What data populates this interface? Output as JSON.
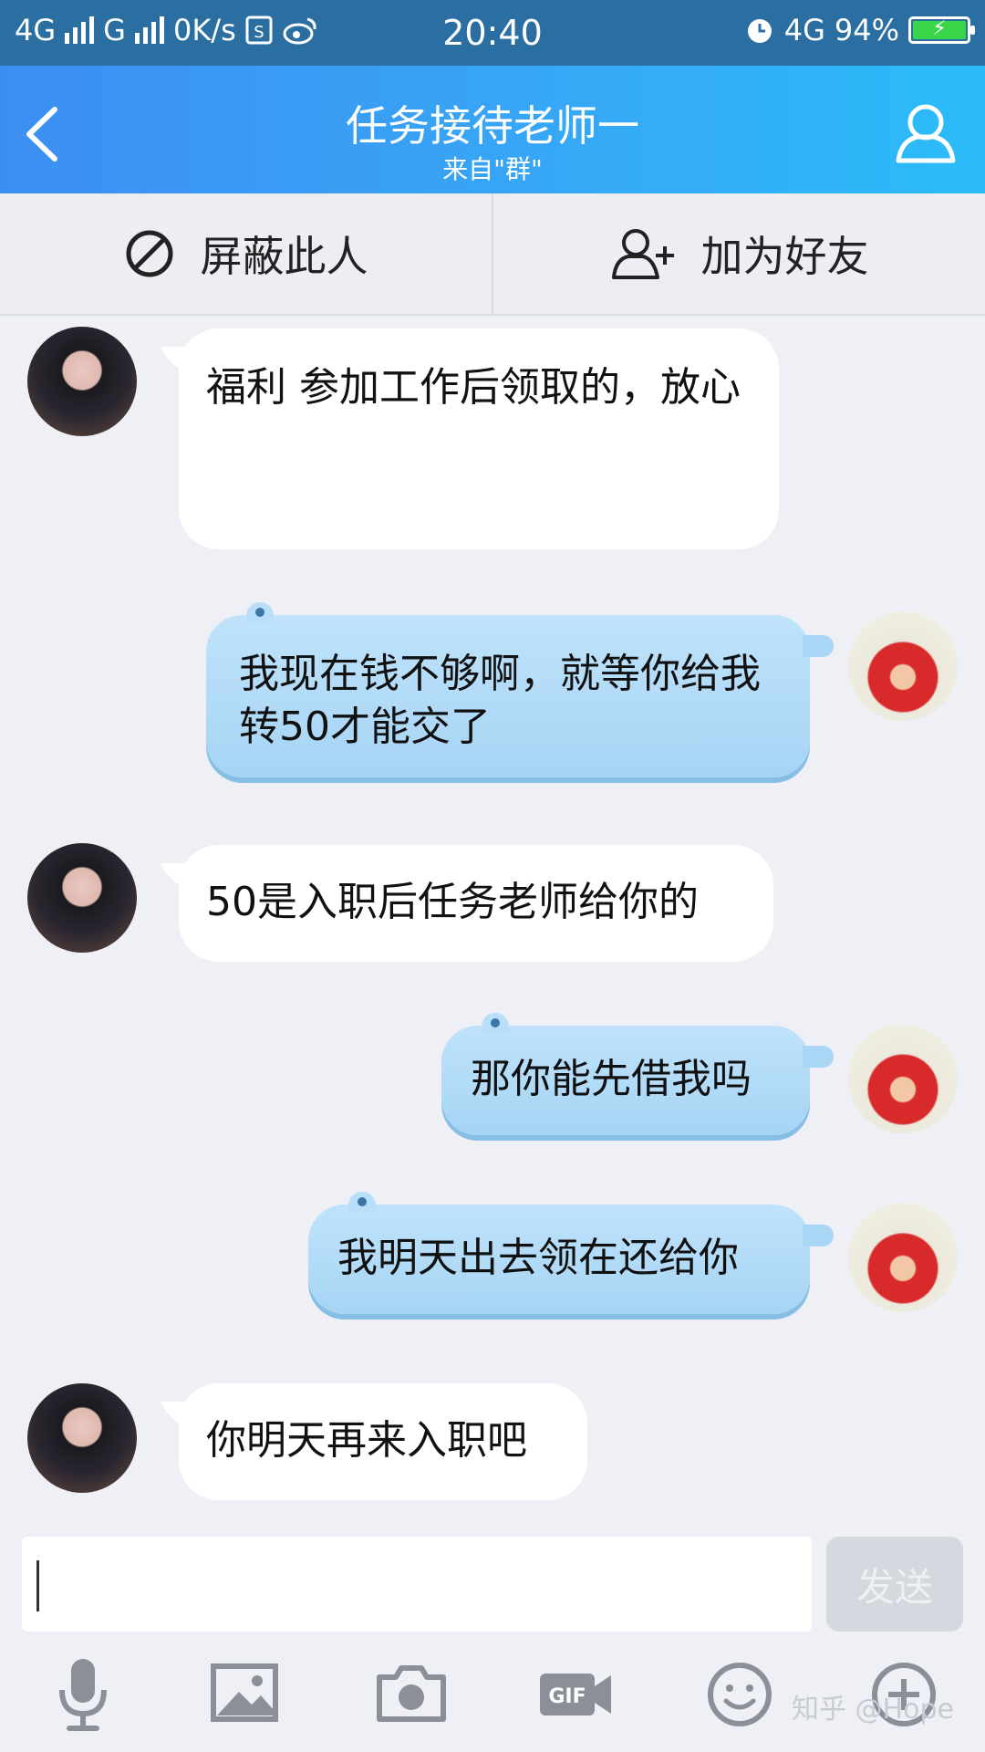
{
  "status_bar": {
    "network1": "4G",
    "network2": "G",
    "speed": "0K/s",
    "time": "20:40",
    "network_right": "4G",
    "battery": "94%",
    "battery_color": "#3ad64a"
  },
  "nav": {
    "title": "任务接待老师一",
    "subtitle": "来自\"群\"",
    "accent": "#3d8ef2"
  },
  "actions": {
    "block_label": "屏蔽此人",
    "add_friend_label": "加为好友"
  },
  "messages": [
    {
      "from": "other",
      "text": "福利 参加工作后领取的，放心"
    },
    {
      "from": "self",
      "text": "我现在钱不够啊，就等你给我转50才能交了"
    },
    {
      "from": "other",
      "text": "50是入职后任务老师给你的"
    },
    {
      "from": "self",
      "text": "那你能先借我吗"
    },
    {
      "from": "self",
      "text": "我明天出去领在还给你"
    },
    {
      "from": "other",
      "text": "你明天再来入职吧"
    }
  ],
  "input": {
    "value": "",
    "send_label": "发送"
  },
  "toolbar": {
    "icons": [
      "microphone-icon",
      "image-icon",
      "camera-icon",
      "gif-icon",
      "emoji-icon",
      "plus-icon"
    ]
  },
  "watermark": "知乎 @Hope"
}
